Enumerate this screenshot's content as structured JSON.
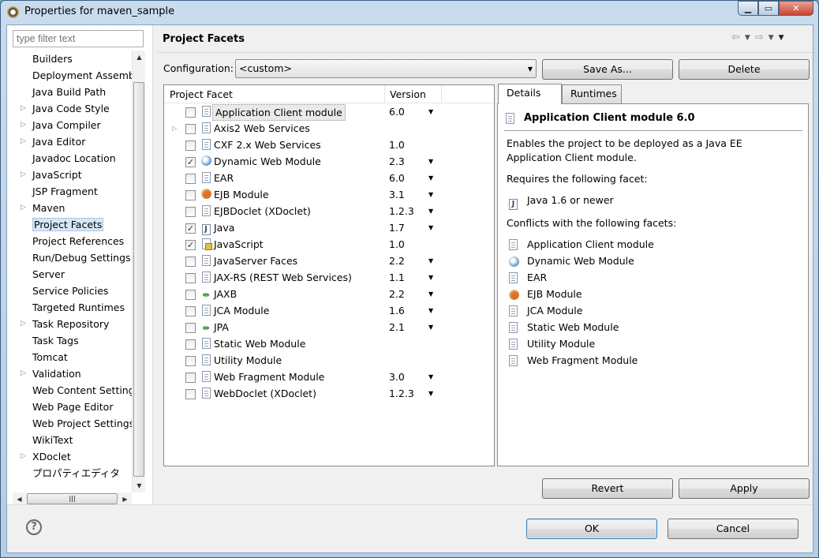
{
  "window": {
    "title": "Properties for maven_sample"
  },
  "filter": {
    "placeholder": "type filter text"
  },
  "tree": [
    {
      "label": "Builders",
      "expandable": false
    },
    {
      "label": "Deployment Assembl",
      "expandable": false
    },
    {
      "label": "Java Build Path",
      "expandable": false
    },
    {
      "label": "Java Code Style",
      "expandable": true
    },
    {
      "label": "Java Compiler",
      "expandable": true
    },
    {
      "label": "Java Editor",
      "expandable": true
    },
    {
      "label": "Javadoc Location",
      "expandable": false
    },
    {
      "label": "JavaScript",
      "expandable": true
    },
    {
      "label": "JSP Fragment",
      "expandable": false
    },
    {
      "label": "Maven",
      "expandable": true
    },
    {
      "label": "Project Facets",
      "expandable": false,
      "selected": true
    },
    {
      "label": "Project References",
      "expandable": false
    },
    {
      "label": "Run/Debug Settings",
      "expandable": false
    },
    {
      "label": "Server",
      "expandable": false
    },
    {
      "label": "Service Policies",
      "expandable": false
    },
    {
      "label": "Targeted Runtimes",
      "expandable": false
    },
    {
      "label": "Task Repository",
      "expandable": true
    },
    {
      "label": "Task Tags",
      "expandable": false
    },
    {
      "label": "Tomcat",
      "expandable": false
    },
    {
      "label": "Validation",
      "expandable": true
    },
    {
      "label": "Web Content Settings",
      "expandable": false
    },
    {
      "label": "Web Page Editor",
      "expandable": false
    },
    {
      "label": "Web Project Settings",
      "expandable": false
    },
    {
      "label": "WikiText",
      "expandable": false
    },
    {
      "label": "XDoclet",
      "expandable": true
    },
    {
      "label": "プロパティエディタ",
      "expandable": false
    }
  ],
  "page": {
    "title": "Project Facets"
  },
  "configuration": {
    "label": "Configuration:",
    "value": "<custom>",
    "save_as": "Save As...",
    "delete": "Delete"
  },
  "facet_table": {
    "headers": {
      "facet": "Project Facet",
      "version": "Version"
    },
    "rows": [
      {
        "name": "Application Client module",
        "version": "6.0",
        "checked": false,
        "dropdown": true,
        "icon": "doc",
        "selected": true
      },
      {
        "name": "Axis2 Web Services",
        "version": "",
        "checked": false,
        "dropdown": false,
        "icon": "doc",
        "expandable": true
      },
      {
        "name": "CXF 2.x Web Services",
        "version": "1.0",
        "checked": false,
        "dropdown": false,
        "icon": "doc"
      },
      {
        "name": "Dynamic Web Module",
        "version": "2.3",
        "checked": true,
        "dropdown": true,
        "icon": "dwm"
      },
      {
        "name": "EAR",
        "version": "6.0",
        "checked": false,
        "dropdown": true,
        "icon": "doc"
      },
      {
        "name": "EJB Module",
        "version": "3.1",
        "checked": false,
        "dropdown": true,
        "icon": "ejb"
      },
      {
        "name": "EJBDoclet (XDoclet)",
        "version": "1.2.3",
        "checked": false,
        "dropdown": true,
        "icon": "doc"
      },
      {
        "name": "Java",
        "version": "1.7",
        "checked": true,
        "dropdown": true,
        "icon": "java"
      },
      {
        "name": "JavaScript",
        "version": "1.0",
        "checked": true,
        "dropdown": false,
        "icon": "js"
      },
      {
        "name": "JavaServer Faces",
        "version": "2.2",
        "checked": false,
        "dropdown": true,
        "icon": "doc"
      },
      {
        "name": "JAX-RS (REST Web Services)",
        "version": "1.1",
        "checked": false,
        "dropdown": true,
        "icon": "doc"
      },
      {
        "name": "JAXB",
        "version": "2.2",
        "checked": false,
        "dropdown": true,
        "icon": "jaxb"
      },
      {
        "name": "JCA Module",
        "version": "1.6",
        "checked": false,
        "dropdown": true,
        "icon": "doc"
      },
      {
        "name": "JPA",
        "version": "2.1",
        "checked": false,
        "dropdown": true,
        "icon": "jaxb"
      },
      {
        "name": "Static Web Module",
        "version": "",
        "checked": false,
        "dropdown": false,
        "icon": "doc"
      },
      {
        "name": "Utility Module",
        "version": "",
        "checked": false,
        "dropdown": false,
        "icon": "doc"
      },
      {
        "name": "Web Fragment Module",
        "version": "3.0",
        "checked": false,
        "dropdown": true,
        "icon": "doc"
      },
      {
        "name": "WebDoclet (XDoclet)",
        "version": "1.2.3",
        "checked": false,
        "dropdown": true,
        "icon": "doc"
      }
    ]
  },
  "tabs": {
    "details": "Details",
    "runtimes": "Runtimes"
  },
  "details": {
    "title": "Application Client module 6.0",
    "description": "Enables the project to be deployed as a Java EE Application Client module.",
    "requires_label": "Requires the following facet:",
    "requires": [
      {
        "name": "Java 1.6 or newer",
        "icon": "java"
      }
    ],
    "conflicts_label": "Conflicts with the following facets:",
    "conflicts": [
      {
        "name": "Application Client module",
        "icon": "doc"
      },
      {
        "name": "Dynamic Web Module",
        "icon": "dwm"
      },
      {
        "name": "EAR",
        "icon": "doc"
      },
      {
        "name": "EJB Module",
        "icon": "ejb"
      },
      {
        "name": "JCA Module",
        "icon": "doc"
      },
      {
        "name": "Static Web Module",
        "icon": "doc"
      },
      {
        "name": "Utility Module",
        "icon": "doc"
      },
      {
        "name": "Web Fragment Module",
        "icon": "doc"
      }
    ]
  },
  "buttons": {
    "revert": "Revert",
    "apply": "Apply",
    "ok": "OK",
    "cancel": "Cancel"
  }
}
